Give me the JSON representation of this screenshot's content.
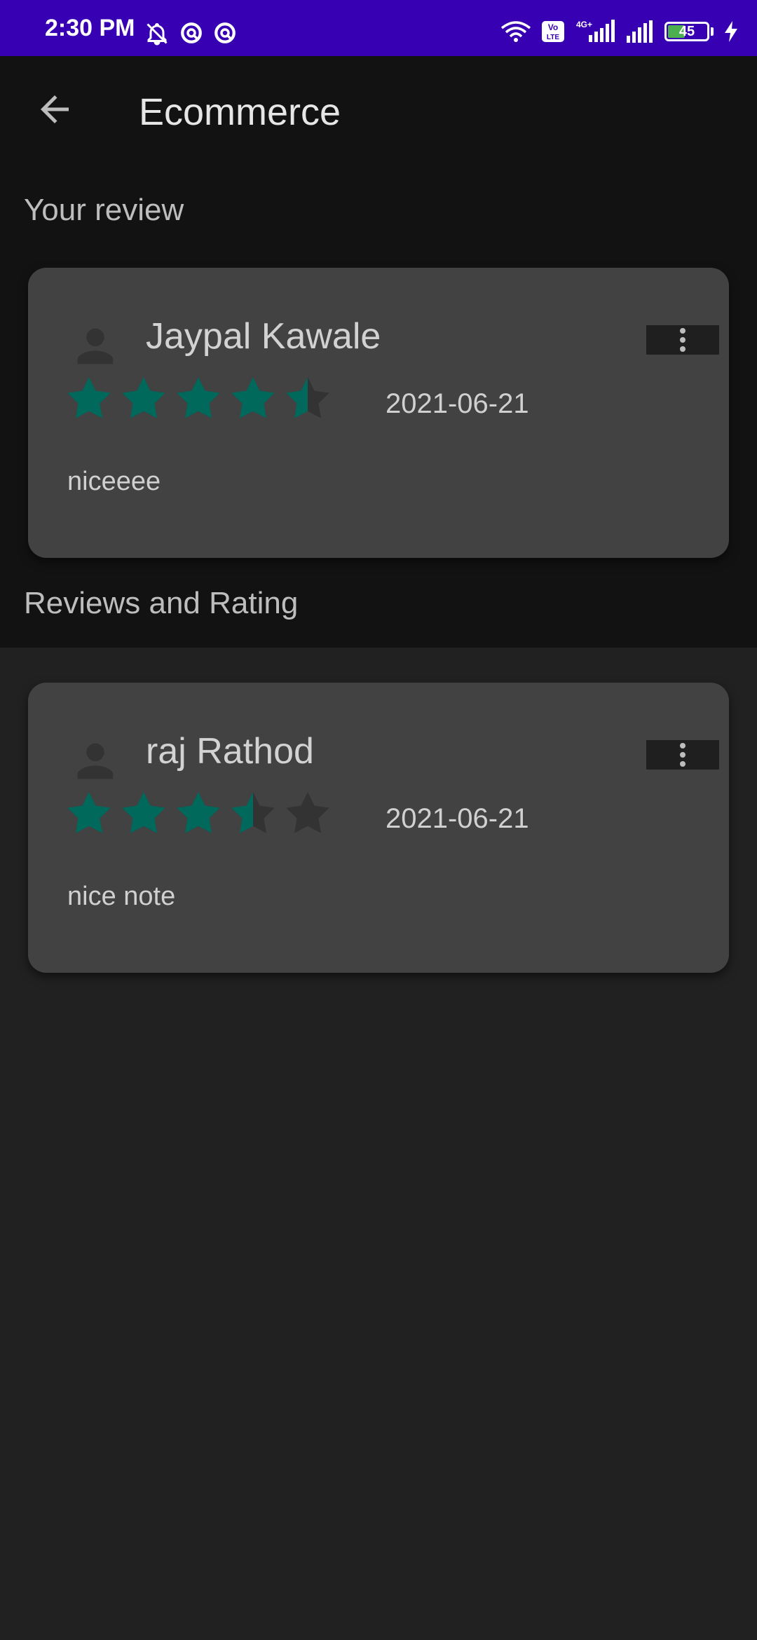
{
  "status_bar": {
    "time": "2:30 PM",
    "battery": "45",
    "network": "4G+",
    "volte": "Vo LTE"
  },
  "toolbar": {
    "title": "Ecommerce"
  },
  "sections": {
    "your_review": "Your review",
    "reviews_and_rating": "Reviews and Rating"
  },
  "your_review": {
    "name": "Jaypal Kawale",
    "rating": 4.5,
    "date": "2021-06-21",
    "comment": "niceeee"
  },
  "reviews": [
    {
      "name": "raj Rathod",
      "rating": 3.5,
      "date": "2021-06-21",
      "comment": "nice note"
    }
  ],
  "colors": {
    "status_bar": "#3700b3",
    "star_filled": "#00695c",
    "star_empty": "#333333",
    "card": "#424242",
    "background": "#212121",
    "header_background": "#121212"
  },
  "icons": {
    "back": "arrow-left-icon",
    "avatar": "person-icon",
    "more": "more-vertical-icon",
    "star": "star-icon"
  }
}
